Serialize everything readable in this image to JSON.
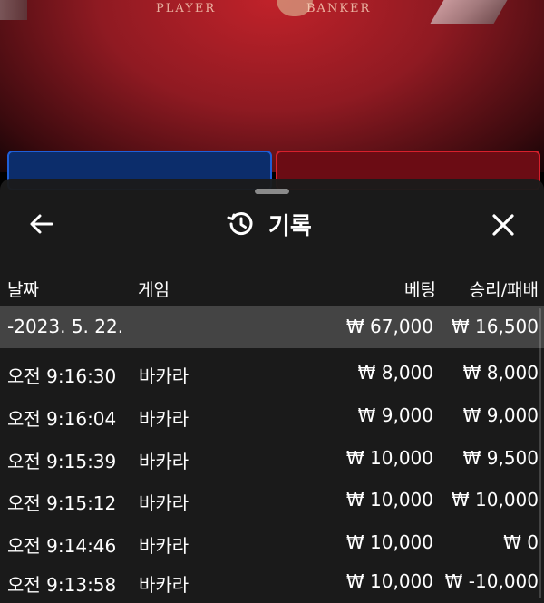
{
  "background": {
    "player_label": "PLAYER",
    "banker_label": "BANKER",
    "player_color": "#1f5fd8",
    "banker_color": "#d8202c"
  },
  "sheet": {
    "title": "기록",
    "title_icon": "history-icon",
    "back_icon": "arrow-left-icon",
    "close_icon": "close-icon",
    "background_color": "#1b1b1b"
  },
  "columns": {
    "date": "날짜",
    "game": "게임",
    "bet": "베팅",
    "win_loss": "승리/패배"
  },
  "date_group": {
    "date": "-2023. 5. 22.",
    "bet_total": "₩ 67,000",
    "win_total": "₩ 16,500"
  },
  "rows": [
    {
      "time": "오전 9:16:30",
      "game": "바카라",
      "bet": "₩ 8,000",
      "win": "₩ 8,000"
    },
    {
      "time": "오전 9:16:04",
      "game": "바카라",
      "bet": "₩ 9,000",
      "win": "₩ 9,000"
    },
    {
      "time": "오전 9:15:39",
      "game": "바카라",
      "bet": "₩ 10,000",
      "win": "₩ 9,500"
    },
    {
      "time": "오전 9:15:12",
      "game": "바카라",
      "bet": "₩ 10,000",
      "win": "₩ 10,000"
    },
    {
      "time": "오전 9:14:46",
      "game": "바카라",
      "bet": "₩ 10,000",
      "win": "₩ 0"
    },
    {
      "time": "오전 9:13:58",
      "game": "바카라",
      "bet": "₩ 10,000",
      "win": "₩ -10,000"
    }
  ]
}
